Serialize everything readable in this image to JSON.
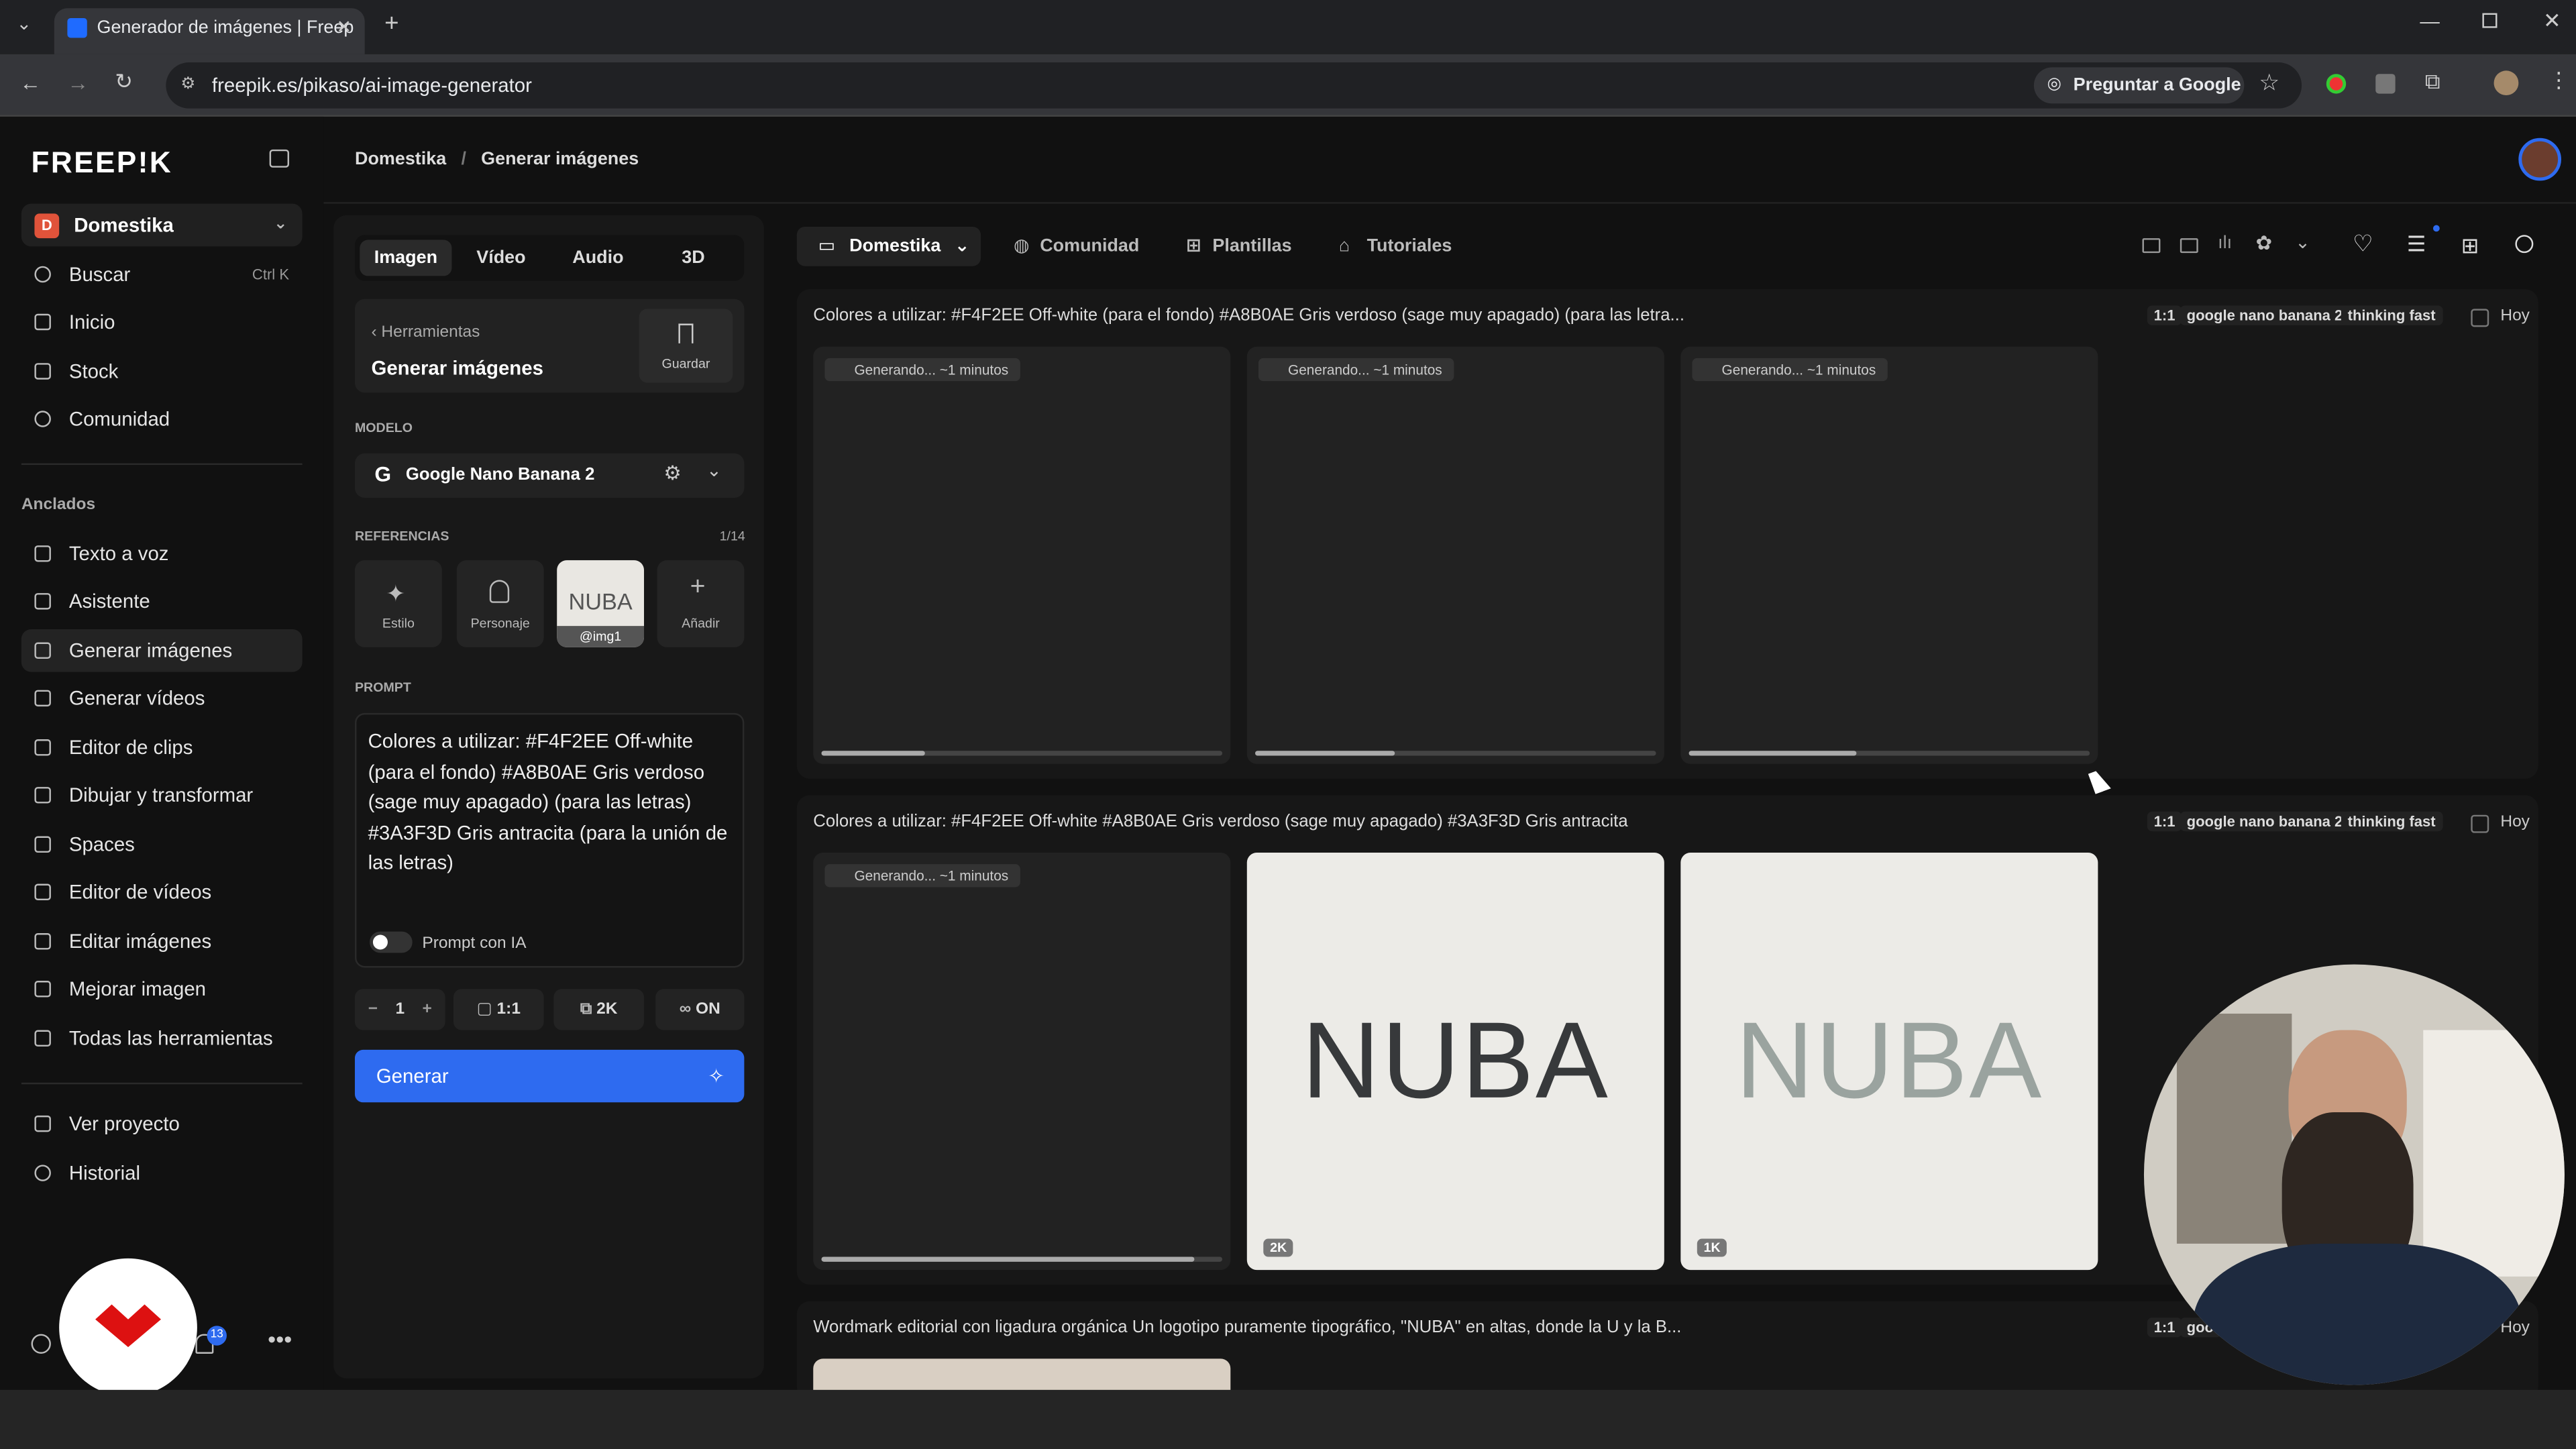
{
  "browser": {
    "tab_title": "Generador de imágenes | Freep",
    "url": "freepik.es/pikaso/ai-image-generator",
    "ask_google": "Preguntar a Google"
  },
  "app": {
    "logo": "FREEP!K",
    "workspace": "Domestika",
    "breadcrumb": [
      "Domestika",
      "Generar imágenes"
    ],
    "nav": [
      {
        "label": "Buscar",
        "shortcut": "Ctrl K",
        "icon": "search-icon"
      },
      {
        "label": "Inicio",
        "icon": "home-icon"
      },
      {
        "label": "Stock",
        "icon": "stock-icon"
      },
      {
        "label": "Comunidad",
        "icon": "globe-icon"
      }
    ],
    "pinned_label": "Anclados",
    "pinned": [
      {
        "label": "Texto a voz",
        "icon": "voice-icon"
      },
      {
        "label": "Asistente",
        "icon": "assistant-icon"
      },
      {
        "label": "Generar imágenes",
        "icon": "image-icon",
        "selected": true
      },
      {
        "label": "Generar vídeos",
        "icon": "video-icon"
      },
      {
        "label": "Editor de clips",
        "icon": "clip-icon"
      },
      {
        "label": "Dibujar y transformar",
        "icon": "draw-icon"
      },
      {
        "label": "Spaces",
        "icon": "spaces-icon"
      },
      {
        "label": "Editor de vídeos",
        "icon": "video-editor-icon"
      },
      {
        "label": "Editar imágenes",
        "icon": "edit-image-icon"
      },
      {
        "label": "Mejorar imagen",
        "icon": "upscale-icon"
      },
      {
        "label": "Todas las herramientas",
        "icon": "grid-icon"
      }
    ],
    "footer_nav": [
      {
        "label": "Ver proyecto",
        "icon": "project-icon"
      },
      {
        "label": "Historial",
        "icon": "history-icon"
      }
    ],
    "notification_count": "13"
  },
  "panel": {
    "tabs": [
      "Imagen",
      "Vídeo",
      "Audio",
      "3D"
    ],
    "back_label": "Herramientas",
    "tool_title": "Generar imágenes",
    "save_label": "Guardar",
    "model_label": "MODELO",
    "model_name": "Google Nano Banana 2",
    "refs_label": "REFERENCIAS",
    "refs_count": "1/14",
    "refs": [
      "Estilo",
      "Personaje",
      "@img1",
      "Añadir"
    ],
    "ref_img_text": "NUBA",
    "prompt_label": "PROMPT",
    "prompt_text": "Colores a utilizar: #F4F2EE Off-white (para el fondo) #A8B0AE Gris verdoso (sage muy apagado) (para las letras) #3A3F3D Gris antracita (para la unión de las letras)",
    "ai_prompt_label": "Prompt con IA",
    "count": "1",
    "ratio": "1:1",
    "resolution": "2K",
    "toggle": "ON",
    "generate_label": "Generar"
  },
  "main": {
    "top_tabs": [
      "Domestika",
      "Comunidad",
      "Plantillas",
      "Tutoriales"
    ],
    "groups": [
      {
        "title": "Colores a utilizar: #F4F2EE Off-white (para el fondo) #A8B0AE Gris verdoso (sage muy apagado) (para las letra...",
        "tags": [
          "1:1",
          "google nano banana 2",
          "thinking fast"
        ],
        "date": "Hoy",
        "tiles": [
          {
            "status": "Generando... ~1 minutos",
            "progress": 0.26
          },
          {
            "status": "Generando... ~1 minutos",
            "progress": 0.35
          },
          {
            "status": "Generando... ~1 minutos",
            "progress": 0.42
          }
        ]
      },
      {
        "title": "Colores a utilizar: #F4F2EE Off-white #A8B0AE Gris verdoso (sage muy apagado) #3A3F3D Gris antracita",
        "tags": [
          "1:1",
          "google nano banana 2",
          "thinking fast"
        ],
        "date": "Hoy",
        "tiles": [
          {
            "status": "Generando... ~1 minutos",
            "progress": 0.93
          },
          {
            "image_text": "NUBA",
            "quality": "2K"
          },
          {
            "image_text": "NUBA",
            "quality": "1K"
          }
        ]
      },
      {
        "title": "Wordmark editorial con ligadura orgánica Un logotipo puramente tipográfico, \"NUBA\" en altas, donde la U y la B...",
        "tags": [
          "1:1",
          "goo"
        ],
        "date": "Hoy"
      }
    ]
  }
}
